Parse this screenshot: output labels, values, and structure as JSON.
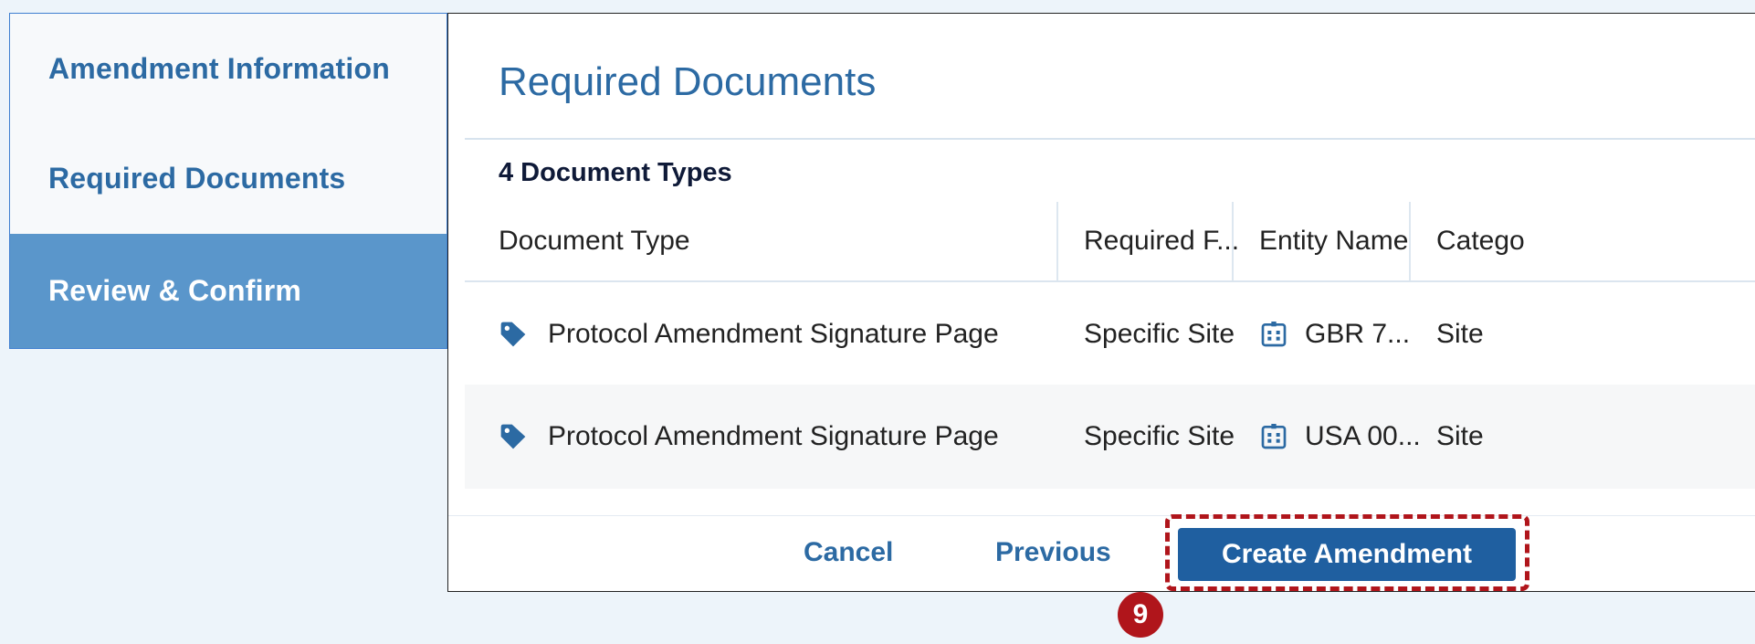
{
  "steps": [
    {
      "label": "Amendment Information"
    },
    {
      "label": "Required Documents"
    },
    {
      "label": "Review & Confirm",
      "active": true
    }
  ],
  "panel": {
    "title": "Required Documents",
    "doc_count": "4 Document Types"
  },
  "table": {
    "columns": [
      "Document Type",
      "Required F...",
      "Entity Name",
      "Catego"
    ],
    "rows": [
      {
        "document_type": "Protocol Amendment Signature Page",
        "required_for": "Specific Site",
        "entity_name": "GBR 7...",
        "category": "Site",
        "type_icon": "tag-icon",
        "entity_icon": "building-icon"
      },
      {
        "document_type": "Protocol Amendment Signature Page",
        "required_for": "Specific Site",
        "entity_name": "USA 00...",
        "category": "Site",
        "type_icon": "tag-icon",
        "entity_icon": "building-icon"
      }
    ]
  },
  "footer": {
    "cancel_label": "Cancel",
    "previous_label": "Previous",
    "create_label": "Create Amendment"
  },
  "annotation": {
    "step_number": "9",
    "color": "#b0151b"
  },
  "colors": {
    "accent": "#2c6aa3",
    "active_step_bg": "#5a96cb",
    "primary_button": "#1f5fa0",
    "page_bg": "#edf4fa"
  }
}
